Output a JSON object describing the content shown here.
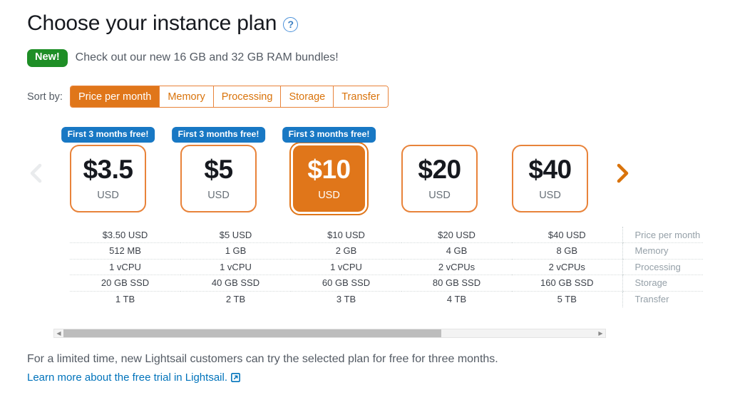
{
  "header": {
    "title": "Choose your instance plan",
    "help_icon": "question-circle-icon",
    "new_badge": "New!",
    "new_text": "Check out our new 16 GB and 32 GB RAM bundles!"
  },
  "sort": {
    "label": "Sort by:",
    "options": [
      {
        "label": "Price per month",
        "active": true
      },
      {
        "label": "Memory",
        "active": false
      },
      {
        "label": "Processing",
        "active": false
      },
      {
        "label": "Storage",
        "active": false
      },
      {
        "label": "Transfer",
        "active": false
      }
    ]
  },
  "carousel": {
    "prev_icon": "chevron-left-icon",
    "next_icon": "chevron-right-icon",
    "prev_enabled": false,
    "next_enabled": true,
    "badge_text": "First 3 months free!",
    "currency": "USD",
    "plans": [
      {
        "price": "$3.5",
        "currency": "USD",
        "badge": true,
        "selected": false
      },
      {
        "price": "$5",
        "currency": "USD",
        "badge": true,
        "selected": false
      },
      {
        "price": "$10",
        "currency": "USD",
        "badge": true,
        "selected": true
      },
      {
        "price": "$20",
        "currency": "USD",
        "badge": false,
        "selected": false
      },
      {
        "price": "$40",
        "currency": "USD",
        "badge": false,
        "selected": false
      }
    ]
  },
  "spec_table": {
    "row_labels": [
      "Price per month",
      "Memory",
      "Processing",
      "Storage",
      "Transfer"
    ],
    "rows": [
      [
        "$3.50 USD",
        "$5 USD",
        "$10 USD",
        "$20 USD",
        "$40 USD"
      ],
      [
        "512 MB",
        "1 GB",
        "2 GB",
        "4 GB",
        "8 GB"
      ],
      [
        "1 vCPU",
        "1 vCPU",
        "1 vCPU",
        "2 vCPUs",
        "2 vCPUs"
      ],
      [
        "20 GB SSD",
        "40 GB SSD",
        "60 GB SSD",
        "80 GB SSD",
        "160 GB SSD"
      ],
      [
        "1 TB",
        "2 TB",
        "3 TB",
        "4 TB",
        "5 TB"
      ]
    ]
  },
  "scrollbar": {
    "left_arrow": "triangle-left-icon",
    "right_arrow": "triangle-right-icon",
    "thumb_percent": 71
  },
  "footer": {
    "note": "For a limited time, new Lightsail customers can try the selected plan for free for three months.",
    "link_text": "Learn more about the free trial in Lightsail.",
    "link_icon": "external-link-icon"
  },
  "colors": {
    "accent_orange": "#e0761a",
    "badge_blue": "#1878c4",
    "badge_green": "#1e8e26",
    "link_blue": "#0073bb"
  }
}
